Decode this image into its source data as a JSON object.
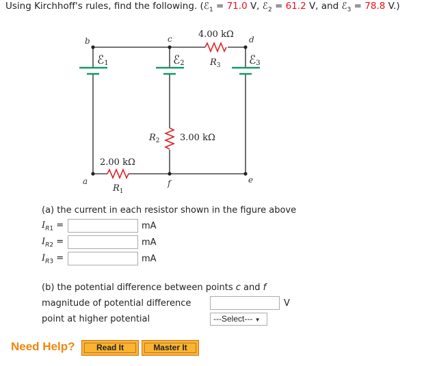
{
  "question": {
    "prefix": "Using Kirchhoff's rules, find the following. (",
    "e1_label": "ℰ",
    "e1_sub": "1",
    "e1_eq": " = ",
    "e1_value": "71.0",
    "e1_unit": " V, ",
    "e2_label": "ℰ",
    "e2_sub": "2",
    "e2_eq": " = ",
    "e2_value": "61.2",
    "e2_unit": " V, and ",
    "e3_label": "ℰ",
    "e3_sub": "3",
    "e3_eq": " = ",
    "e3_value": "78.8",
    "e3_unit": " V.)"
  },
  "circuit": {
    "nodes": {
      "a": "a",
      "b": "b",
      "c": "c",
      "d": "d",
      "e": "e",
      "f": "f"
    },
    "emf1": "ℰ",
    "emf1_sub": "1",
    "emf2": "ℰ",
    "emf2_sub": "2",
    "emf3": "ℰ",
    "emf3_sub": "3",
    "r1_label": "R",
    "r1_sub": "1",
    "r1_value": "2.00 kΩ",
    "r2_label": "R",
    "r2_sub": "2",
    "r2_value": "3.00 kΩ",
    "r3_label": "R",
    "r3_sub": "3",
    "r3_value": "4.00 kΩ",
    "colors": {
      "resistor": "#e0202a",
      "battery": "#119966",
      "wire": "#222222"
    }
  },
  "part_a": {
    "prompt": "(a) the current in each resistor shown in the figure above",
    "rows": [
      {
        "label": "I",
        "sub": "R",
        "subsub": "1",
        "eq": " =",
        "value": "",
        "unit": "mA"
      },
      {
        "label": "I",
        "sub": "R",
        "subsub": "2",
        "eq": " =",
        "value": "",
        "unit": "mA"
      },
      {
        "label": "I",
        "sub": "R",
        "subsub": "3",
        "eq": " =",
        "value": "",
        "unit": "mA"
      }
    ]
  },
  "part_b": {
    "prompt_pre": "(b) the potential difference between points ",
    "c": "c",
    "and": " and ",
    "f": "f",
    "magnitude_label": "magnitude of potential difference",
    "magnitude_value": "",
    "magnitude_unit": "V",
    "higher_label": "point at higher potential",
    "select_value": "---Select---",
    "select_arrow": "▼"
  },
  "help": {
    "label": "Need Help?",
    "read_it": "Read It",
    "master_it": "Master It"
  }
}
